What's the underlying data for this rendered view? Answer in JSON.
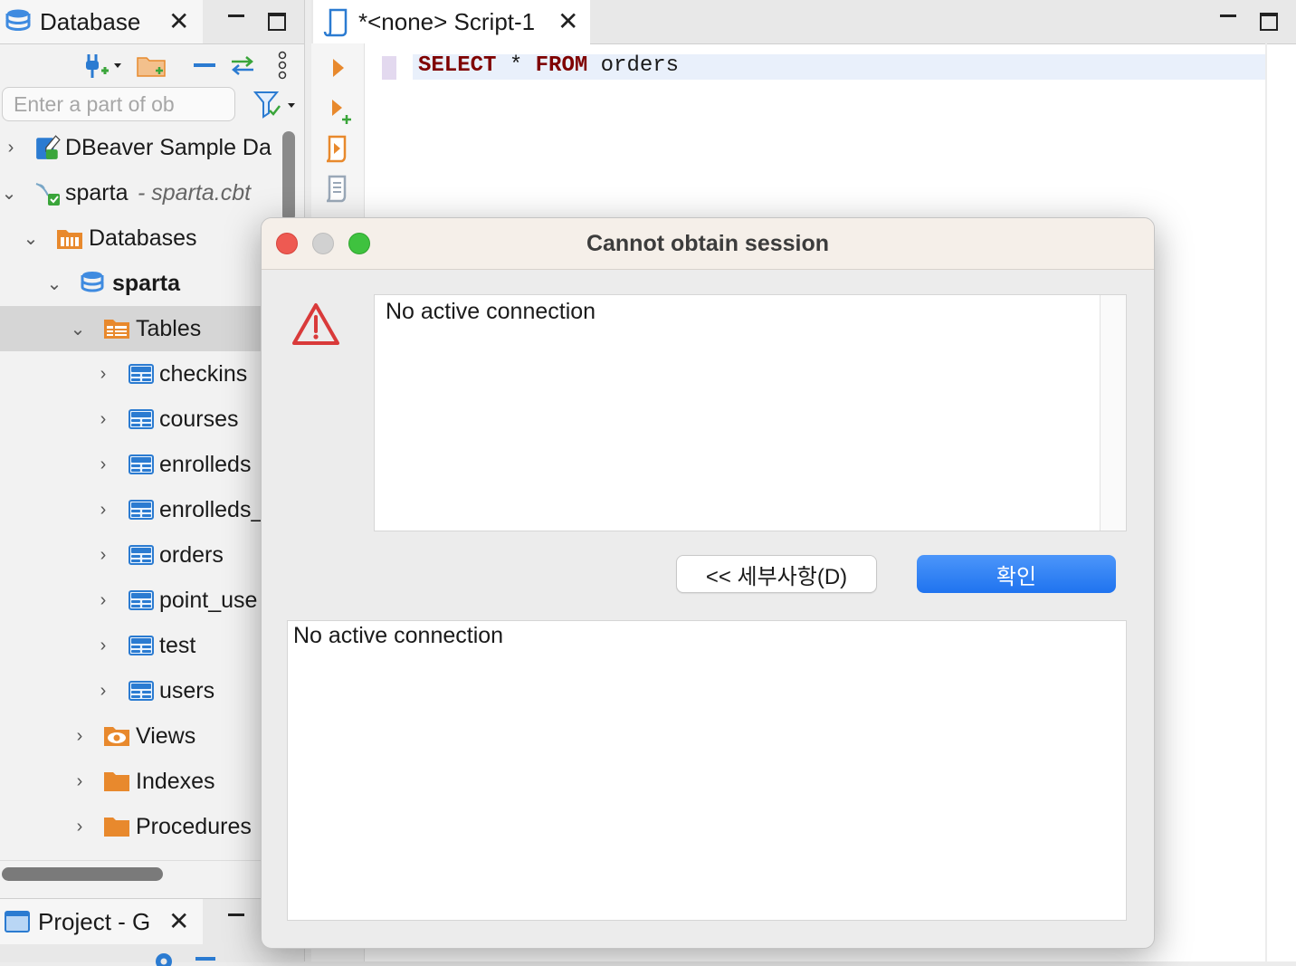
{
  "navigator": {
    "tab_label": "Database",
    "filter_placeholder": "Enter a part of ob",
    "tree": [
      {
        "label": "DBeaver Sample Da",
        "suffix": ""
      },
      {
        "label": "sparta",
        "suffix": " - sparta.cbt"
      },
      {
        "label": "Databases"
      },
      {
        "label": "sparta"
      },
      {
        "label": "Tables"
      },
      {
        "label": "checkins"
      },
      {
        "label": "courses"
      },
      {
        "label": "enrolleds"
      },
      {
        "label": "enrolleds_"
      },
      {
        "label": "orders"
      },
      {
        "label": "point_use"
      },
      {
        "label": "test"
      },
      {
        "label": "users"
      },
      {
        "label": "Views"
      },
      {
        "label": "Indexes"
      },
      {
        "label": "Procedures"
      }
    ],
    "project_tab_label": "Project - G"
  },
  "editor": {
    "tab_label": "*<none> Script-1",
    "sql": {
      "kw1": "SELECT",
      "star": " * ",
      "kw2": "FROM",
      "table": " orders"
    }
  },
  "dialog": {
    "title": "Cannot obtain session",
    "message": "No active connection",
    "details_button": "<< 세부사항(D)",
    "ok_button": "확인",
    "details_text": "No active connection"
  },
  "colors": {
    "accent_blue": "#2b7bd1",
    "folder_orange": "#e8892d",
    "keyword": "#7f0000",
    "close_red": "#ee5a52",
    "zoom_green": "#3fc23f",
    "warning_red": "#d93a3a"
  }
}
